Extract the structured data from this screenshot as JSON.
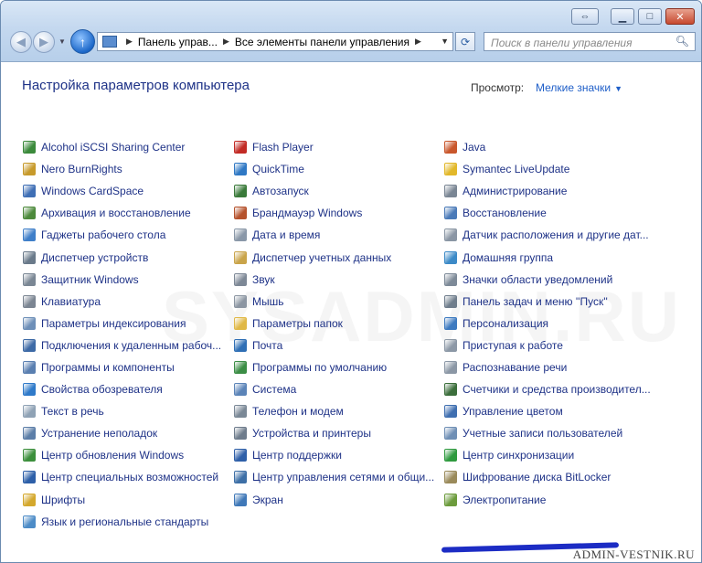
{
  "window": {
    "address": {
      "crumb1": "Панель управ...",
      "crumb2": "Все элементы панели управления"
    },
    "search": {
      "placeholder": "Поиск в панели управления"
    }
  },
  "header": {
    "title": "Настройка параметров компьютера",
    "view_label": "Просмотр:",
    "view_value": "Мелкие значки"
  },
  "watermarks": {
    "footer": "ADMIN-VESTNIK.RU",
    "center": "SYSADMIN.RU"
  },
  "columns": [
    [
      {
        "label": "Alcohol iSCSI Sharing Center",
        "icon": "alcohol-icon",
        "color": "#3b8a3b"
      },
      {
        "label": "Nero BurnRights",
        "icon": "nero-icon",
        "color": "#c79a2b"
      },
      {
        "label": "Windows CardSpace",
        "icon": "cardspace-icon",
        "color": "#3f6fb5"
      },
      {
        "label": "Архивация и восстановление",
        "icon": "backup-icon",
        "color": "#4d8a3c"
      },
      {
        "label": "Гаджеты рабочего стола",
        "icon": "gadgets-icon",
        "color": "#3f7fc9"
      },
      {
        "label": "Диспетчер устройств",
        "icon": "device-manager-icon",
        "color": "#6a7a8a"
      },
      {
        "label": "Защитник Windows",
        "icon": "defender-icon",
        "color": "#7a8794"
      },
      {
        "label": "Клавиатура",
        "icon": "keyboard-icon",
        "color": "#7b8592"
      },
      {
        "label": "Параметры индексирования",
        "icon": "indexing-icon",
        "color": "#6d8fb8"
      },
      {
        "label": "Подключения к удаленным рабоч...",
        "icon": "remote-desktop-icon",
        "color": "#3d6aa6"
      },
      {
        "label": "Программы и компоненты",
        "icon": "programs-icon",
        "color": "#5a7fb0"
      },
      {
        "label": "Свойства обозревателя",
        "icon": "internet-options-icon",
        "color": "#2f7ac9"
      },
      {
        "label": "Текст в речь",
        "icon": "speech-icon",
        "color": "#8fa2b5"
      },
      {
        "label": "Устранение неполадок",
        "icon": "troubleshooting-icon",
        "color": "#5c7ea8"
      },
      {
        "label": "Центр обновления Windows",
        "icon": "windows-update-icon",
        "color": "#3c8f3c"
      },
      {
        "label": "Центр специальных возможностей",
        "icon": "accessibility-icon",
        "color": "#2d5fa8"
      },
      {
        "label": "Шрифты",
        "icon": "fonts-icon",
        "color": "#d4a82d"
      },
      {
        "label": "Язык и региональные стандарты",
        "icon": "region-icon",
        "color": "#4d8cc7"
      }
    ],
    [
      {
        "label": "Flash Player",
        "icon": "flash-icon",
        "color": "#c22b25"
      },
      {
        "label": "QuickTime",
        "icon": "quicktime-icon",
        "color": "#2f78c4"
      },
      {
        "label": "Автозапуск",
        "icon": "autoplay-icon",
        "color": "#3a7a3a"
      },
      {
        "label": "Брандмауэр Windows",
        "icon": "firewall-icon",
        "color": "#b5522c"
      },
      {
        "label": "Дата и время",
        "icon": "datetime-icon",
        "color": "#8a98a8"
      },
      {
        "label": "Диспетчер учетных данных",
        "icon": "credentials-icon",
        "color": "#c9a44a"
      },
      {
        "label": "Звук",
        "icon": "sound-icon",
        "color": "#7d8896"
      },
      {
        "label": "Мышь",
        "icon": "mouse-icon",
        "color": "#8c96a2"
      },
      {
        "label": "Параметры папок",
        "icon": "folder-options-icon",
        "color": "#e0b846"
      },
      {
        "label": "Почта",
        "icon": "mail-icon",
        "color": "#2f6fb5"
      },
      {
        "label": "Программы по умолчанию",
        "icon": "default-programs-icon",
        "color": "#3b8d45"
      },
      {
        "label": "Система",
        "icon": "system-icon",
        "color": "#5b84b8"
      },
      {
        "label": "Телефон и модем",
        "icon": "phone-modem-icon",
        "color": "#7a8896"
      },
      {
        "label": "Устройства и принтеры",
        "icon": "devices-printers-icon",
        "color": "#6e7c8c"
      },
      {
        "label": "Центр поддержки",
        "icon": "action-center-icon",
        "color": "#2e5fa8"
      },
      {
        "label": "Центр управления сетями и общи...",
        "icon": "network-center-icon",
        "color": "#3d6fa6"
      },
      {
        "label": "Экран",
        "icon": "display-icon",
        "color": "#3f78b8"
      }
    ],
    [
      {
        "label": "Java",
        "icon": "java-icon",
        "color": "#c9572c"
      },
      {
        "label": "Symantec LiveUpdate",
        "icon": "liveupdate-icon",
        "color": "#e2b82a"
      },
      {
        "label": "Администрирование",
        "icon": "admin-tools-icon",
        "color": "#7a8694"
      },
      {
        "label": "Восстановление",
        "icon": "recovery-icon",
        "color": "#4a7ab8"
      },
      {
        "label": "Датчик расположения и другие дат...",
        "icon": "location-sensor-icon",
        "color": "#8a96a4"
      },
      {
        "label": "Домашняя группа",
        "icon": "homegroup-icon",
        "color": "#3c8ac7"
      },
      {
        "label": "Значки области уведомлений",
        "icon": "notification-icons-icon",
        "color": "#7d8a98"
      },
      {
        "label": "Панель задач и меню ''Пуск''",
        "icon": "taskbar-icon",
        "color": "#6f7d8c"
      },
      {
        "label": "Персонализация",
        "icon": "personalization-icon",
        "color": "#3d7ac0"
      },
      {
        "label": "Приступая к работе",
        "icon": "getting-started-icon",
        "color": "#8c98a6"
      },
      {
        "label": "Распознавание речи",
        "icon": "speech-recognition-icon",
        "color": "#8b97a5"
      },
      {
        "label": "Счетчики и средства производител...",
        "icon": "performance-icon",
        "color": "#3b6e3b"
      },
      {
        "label": "Управление цветом",
        "icon": "color-management-icon",
        "color": "#3f6fb0"
      },
      {
        "label": "Учетные записи пользователей",
        "icon": "user-accounts-icon",
        "color": "#6f8fb5"
      },
      {
        "label": "Центр синхронизации",
        "icon": "sync-center-icon",
        "color": "#2f9a3f"
      },
      {
        "label": "Шифрование диска BitLocker",
        "icon": "bitlocker-icon",
        "color": "#9a8a5a"
      },
      {
        "label": "Электропитание",
        "icon": "power-options-icon",
        "color": "#6c9b3c"
      }
    ]
  ]
}
